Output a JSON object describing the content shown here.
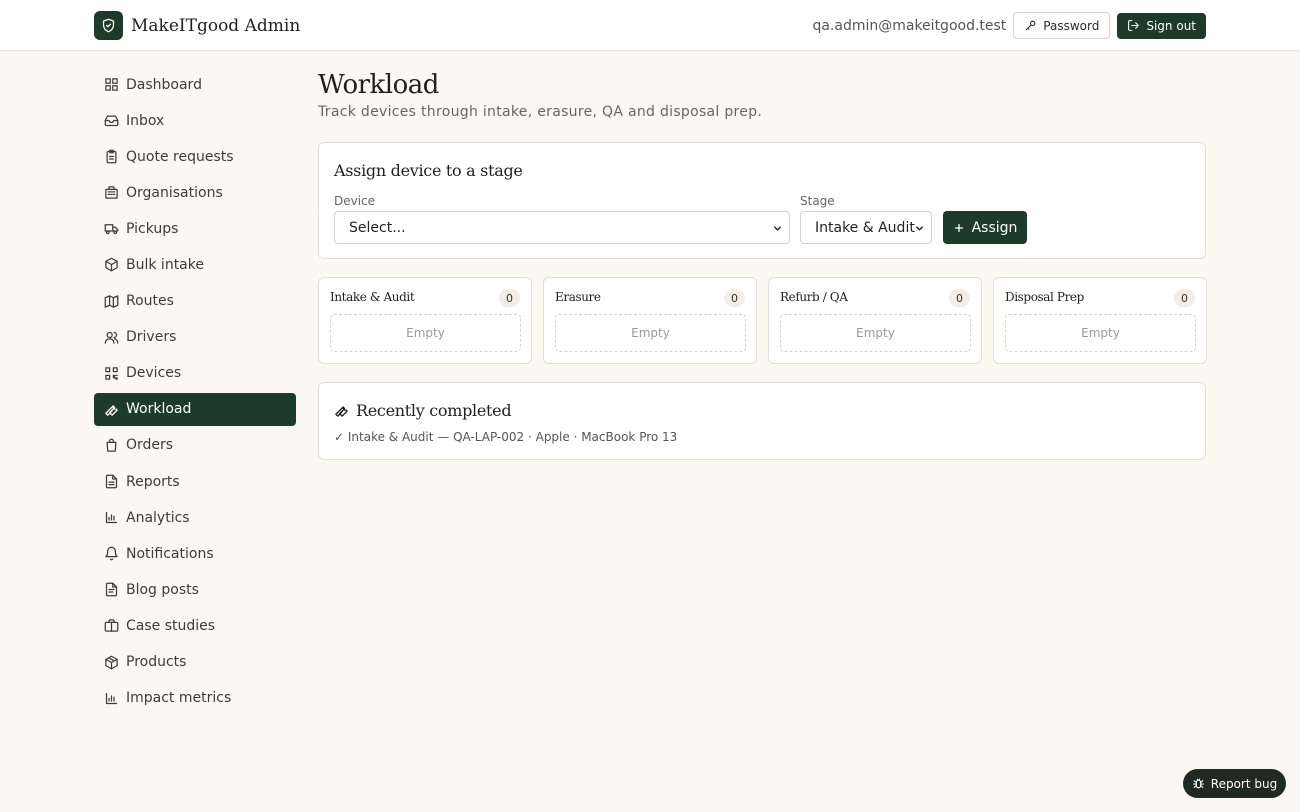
{
  "header": {
    "brand": "MakeITgood Admin",
    "user_email": "qa.admin@makeitgood.test",
    "password_label": "Password",
    "signout_label": "Sign out"
  },
  "sidebar": {
    "items": [
      {
        "label": "Dashboard",
        "icon": "dashboard-icon"
      },
      {
        "label": "Inbox",
        "icon": "inbox-icon"
      },
      {
        "label": "Quote requests",
        "icon": "clipboard-icon"
      },
      {
        "label": "Organisations",
        "icon": "building-icon"
      },
      {
        "label": "Pickups",
        "icon": "truck-icon"
      },
      {
        "label": "Bulk intake",
        "icon": "package-icon"
      },
      {
        "label": "Routes",
        "icon": "map-icon"
      },
      {
        "label": "Drivers",
        "icon": "users-icon"
      },
      {
        "label": "Devices",
        "icon": "qr-code-icon"
      },
      {
        "label": "Workload",
        "icon": "wrench-icon",
        "active": true
      },
      {
        "label": "Orders",
        "icon": "shopping-bag-icon"
      },
      {
        "label": "Reports",
        "icon": "file-text-icon"
      },
      {
        "label": "Analytics",
        "icon": "bar-chart-icon"
      },
      {
        "label": "Notifications",
        "icon": "bell-icon"
      },
      {
        "label": "Blog posts",
        "icon": "file-icon"
      },
      {
        "label": "Case studies",
        "icon": "briefcase-icon"
      },
      {
        "label": "Products",
        "icon": "box-icon"
      },
      {
        "label": "Impact metrics",
        "icon": "bar-chart-icon"
      }
    ]
  },
  "main": {
    "title": "Workload",
    "subtitle": "Track devices through intake, erasure, QA and disposal prep.",
    "assign": {
      "title": "Assign device to a stage",
      "device_label": "Device",
      "device_value": "Select...",
      "stage_label": "Stage",
      "stage_value": "Intake & Audit",
      "button_label": "Assign"
    },
    "stages": [
      {
        "name": "Intake & Audit",
        "count": "0",
        "empty": "Empty"
      },
      {
        "name": "Erasure",
        "count": "0",
        "empty": "Empty"
      },
      {
        "name": "Refurb / QA",
        "count": "0",
        "empty": "Empty"
      },
      {
        "name": "Disposal Prep",
        "count": "0",
        "empty": "Empty"
      }
    ],
    "recent": {
      "title": "Recently completed",
      "items": [
        "✓ Intake & Audit — QA-LAP-002 · Apple · MacBook Pro 13"
      ]
    }
  },
  "report_bug_label": "Report bug",
  "colors": {
    "accent": "#1d3b2a",
    "background": "#fbf8f2"
  }
}
